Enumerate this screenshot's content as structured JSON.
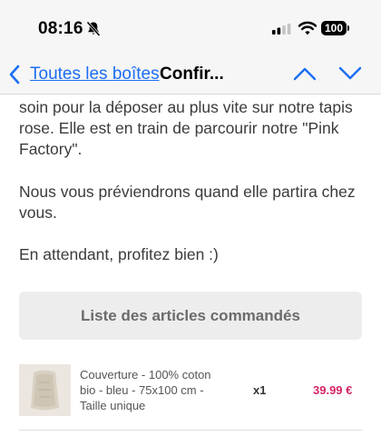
{
  "status_bar": {
    "time": "08:16",
    "battery": "100",
    "icons": [
      "bell-muted-icon",
      "signal-icon",
      "wifi-icon",
      "battery-icon"
    ]
  },
  "nav": {
    "back_label": "Toutes les boîtes",
    "title": "Confir...",
    "accent_color": "#1b6ef3"
  },
  "email": {
    "paragraph_1": "soin pour la déposer au plus vite sur notre tapis rose. Elle est en train de parcourir notre \"Pink Factory\".",
    "paragraph_2": "Nous vous préviendrons quand elle partira chez vous.",
    "paragraph_3": "En attendant, profitez bien :)"
  },
  "order": {
    "header": "Liste des articles commandés",
    "items": [
      {
        "description": "Couverture - 100% coton bio - bleu - 75x100 cm - Taille unique",
        "quantity": "x1",
        "price": "39.99 €",
        "price_color": "#d6266a"
      }
    ]
  }
}
